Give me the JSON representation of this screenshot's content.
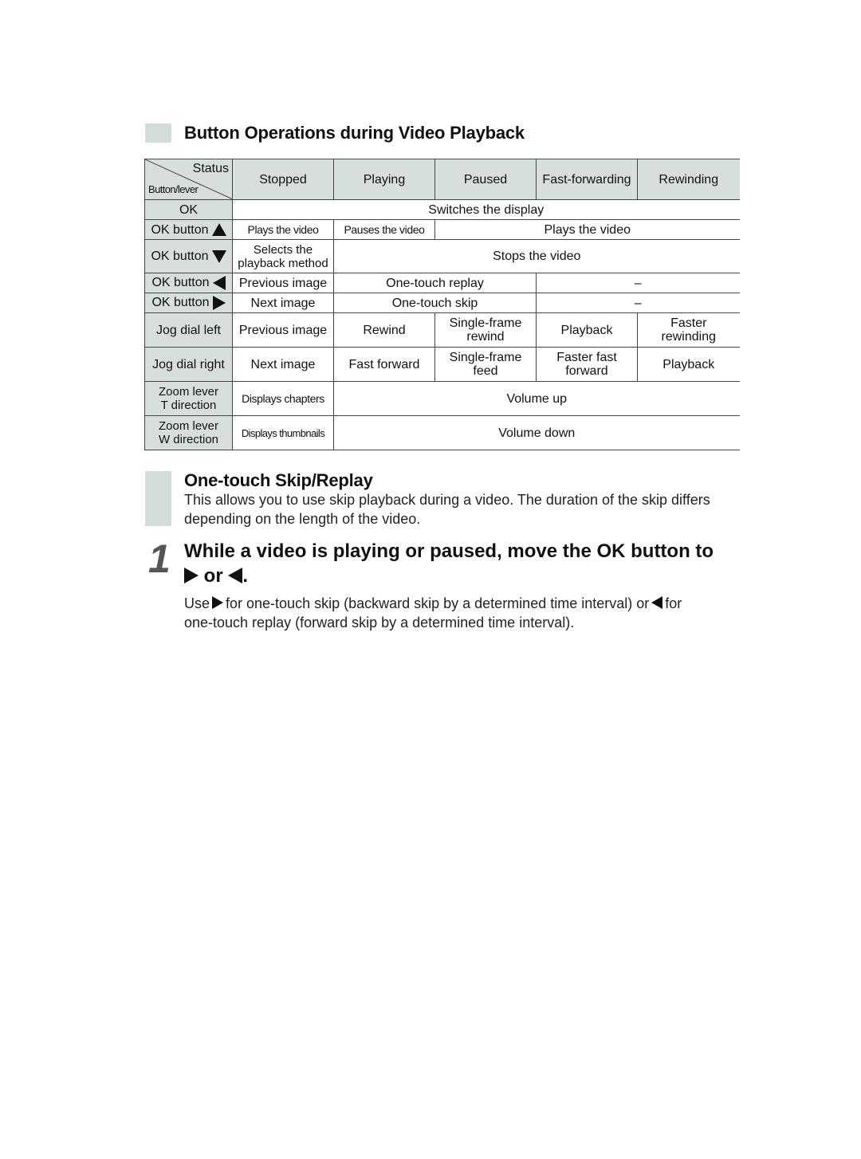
{
  "section1": {
    "title": "Button Operations during Video Playback"
  },
  "table": {
    "corner": {
      "status": "Status",
      "button_lever": "Button/lever"
    },
    "columns": [
      "Stopped",
      "Playing",
      "Paused",
      "Fast-forwarding",
      "Rewinding"
    ],
    "rows": {
      "ok": {
        "label": "OK",
        "all": "Switches the display"
      },
      "ok_up": {
        "label": "OK button",
        "icon": "triangle-up-icon",
        "stopped": "Plays the video",
        "playing": "Pauses the video",
        "paused_ff_rw": "Plays the video"
      },
      "ok_down": {
        "label": "OK button",
        "icon": "triangle-down-icon",
        "stopped_l1": "Selects the",
        "stopped_l2": "playback method",
        "rest": "Stops the video"
      },
      "ok_left": {
        "label": "OK button",
        "icon": "triangle-left-icon",
        "stopped": "Previous image",
        "playing_paused": "One-touch replay",
        "ff_rw": "–"
      },
      "ok_right": {
        "label": "OK button",
        "icon": "triangle-right-icon",
        "stopped": "Next image",
        "playing_paused": "One-touch skip",
        "ff_rw": "–"
      },
      "jog_left": {
        "label": "Jog dial left",
        "stopped": "Previous image",
        "playing": "Rewind",
        "paused_l1": "Single-frame",
        "paused_l2": "rewind",
        "ff": "Playback",
        "rw_l1": "Faster",
        "rw_l2": "rewinding"
      },
      "jog_right": {
        "label": "Jog dial right",
        "stopped": "Next image",
        "playing": "Fast forward",
        "paused_l1": "Single-frame",
        "paused_l2": "feed",
        "ff_l1": "Faster fast",
        "ff_l2": "forward",
        "rw": "Playback"
      },
      "zoom_t": {
        "label_l1": "Zoom lever",
        "label_l2": "T direction",
        "stopped": "Displays chapters",
        "rest": "Volume up"
      },
      "zoom_w": {
        "label_l1": "Zoom lever",
        "label_l2": "W direction",
        "stopped": "Displays thumbnails",
        "rest": "Volume down"
      }
    }
  },
  "section2": {
    "title": "One-touch Skip/Replay",
    "body": "This allows you to use skip playback during a video. The duration of the skip differs depending on the length of the video."
  },
  "step1": {
    "number": "1",
    "title_main": "While a video is playing or paused, move the OK button to",
    "title_or": " or ",
    "title_end": ".",
    "body_use": "Use",
    "body_mid": "for one-touch skip (backward skip by a determined time interval) or",
    "body_for": "for",
    "body_end": "one-touch replay (forward skip by a determined time interval)."
  },
  "colors": {
    "header_fill": "#d6dfdc",
    "marker_fill": "#d3dcd9"
  }
}
